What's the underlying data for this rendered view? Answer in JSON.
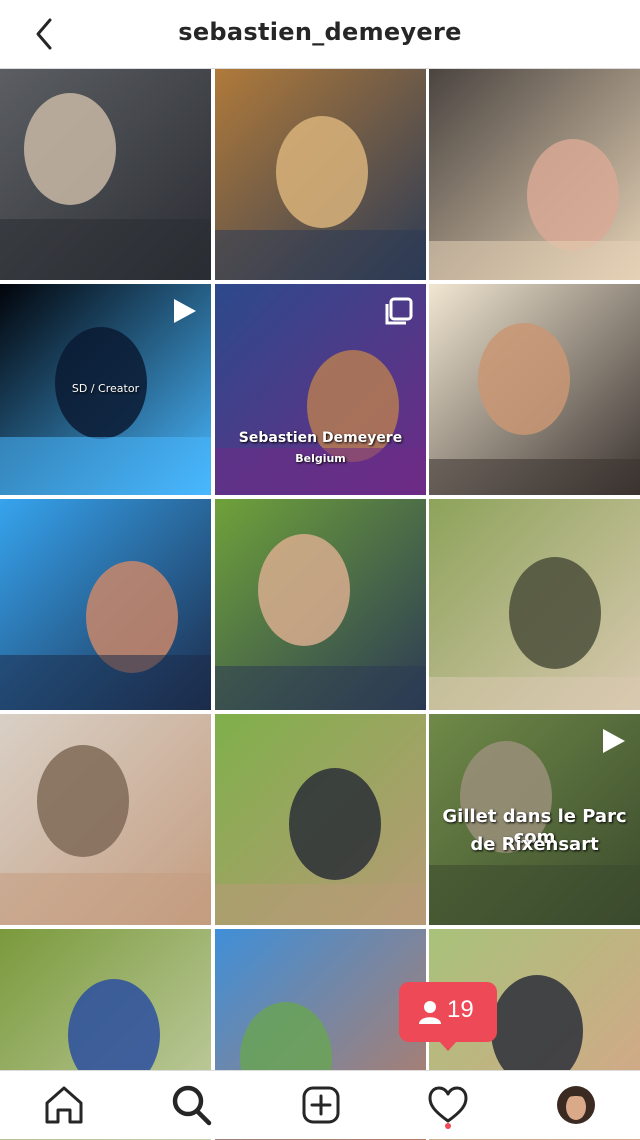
{
  "header": {
    "username": "sebastien_demeyere"
  },
  "posts": [
    {
      "id": 1,
      "type": "photo",
      "caption": "",
      "colors": [
        "#5b5e62",
        "#c9b9a6",
        "#2a2d33"
      ]
    },
    {
      "id": 2,
      "type": "photo",
      "caption": "",
      "colors": [
        "#b07a3a",
        "#d9b37a",
        "#2c3b55"
      ]
    },
    {
      "id": 3,
      "type": "photo",
      "caption": "",
      "colors": [
        "#4a4440",
        "#d8a995",
        "#e6d2b6"
      ]
    },
    {
      "id": 4,
      "type": "video",
      "caption": "SD / Creator",
      "colors": [
        "#02040a",
        "#0a1a33",
        "#49b8ff"
      ]
    },
    {
      "id": 5,
      "type": "carousel",
      "caption": "Sebastien Demeyere",
      "subcaption": "Belgium",
      "colors": [
        "#2c4a8b",
        "#b57b52",
        "#6e2b86"
      ]
    },
    {
      "id": 6,
      "type": "photo",
      "caption": "",
      "colors": [
        "#f1e6d1",
        "#c99673",
        "#3a3330"
      ]
    },
    {
      "id": 7,
      "type": "photo",
      "caption": "",
      "colors": [
        "#36a4ee",
        "#c9876a",
        "#1c2b4a"
      ]
    },
    {
      "id": 8,
      "type": "photo",
      "caption": "",
      "colors": [
        "#6fa23a",
        "#d8ad8e",
        "#2b3a54"
      ]
    },
    {
      "id": 9,
      "type": "photo",
      "caption": "",
      "colors": [
        "#8da35a",
        "#4b4f3a",
        "#d9c9b0"
      ]
    },
    {
      "id": 10,
      "type": "photo",
      "caption": "",
      "colors": [
        "#d9d0c6",
        "#7f6a57",
        "#c49d80"
      ]
    },
    {
      "id": 11,
      "type": "photo",
      "caption": "",
      "colors": [
        "#7fb04a",
        "#2a2f36",
        "#b89a78"
      ]
    },
    {
      "id": 12,
      "type": "video",
      "caption": "Gillet dans le Parc com",
      "subcaption": "de Rixensart",
      "colors": [
        "#6f8a48",
        "#9a8f7a",
        "#3b4a2d"
      ]
    },
    {
      "id": 13,
      "type": "photo",
      "caption": "",
      "colors": [
        "#7a9a3c",
        "#2b4fa0",
        "#c6d0a8"
      ]
    },
    {
      "id": 14,
      "type": "photo",
      "caption": "",
      "colors": [
        "#3f8fd8",
        "#6aa356",
        "#b97c63"
      ]
    },
    {
      "id": 15,
      "type": "photo",
      "caption": "",
      "colors": [
        "#a8c27a",
        "#2b2f3a",
        "#d8a58a"
      ]
    }
  ],
  "notification": {
    "count": "19"
  },
  "tabs": [
    "home",
    "search",
    "new-post",
    "activity",
    "profile"
  ],
  "colors": {
    "accent": "#ed4956",
    "icon": "#262626"
  }
}
